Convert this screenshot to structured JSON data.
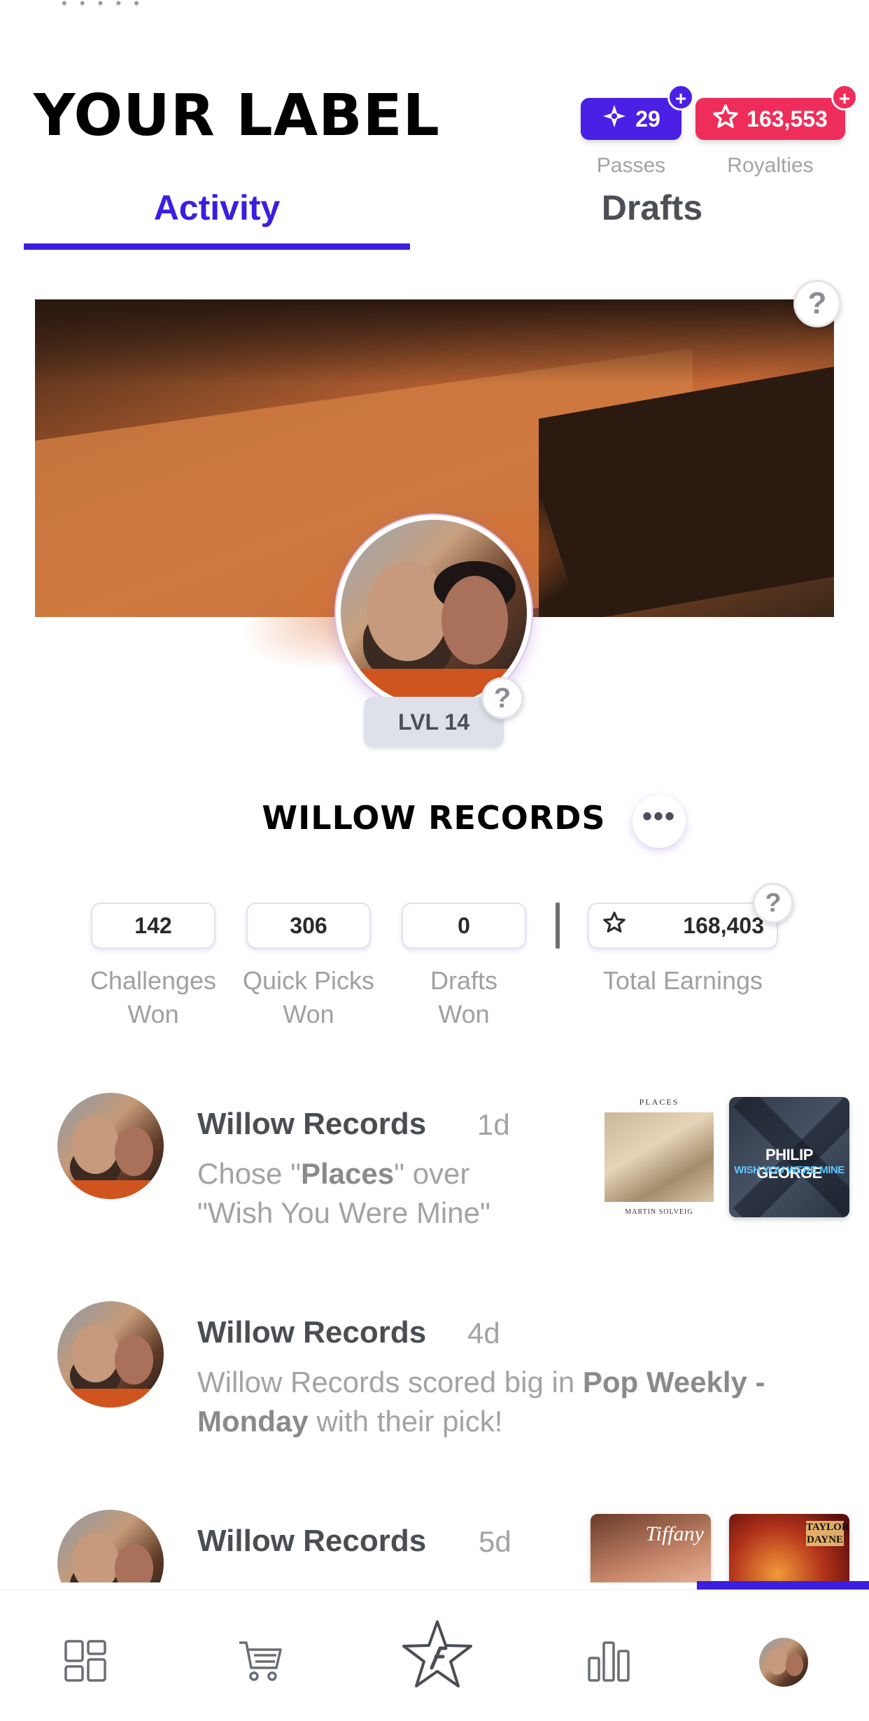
{
  "header": {
    "title": "YOUR LABEL",
    "passes": {
      "value": "29",
      "label": "Passes",
      "color": "#4a1fe6"
    },
    "royalties": {
      "value": "163,553",
      "label": "Royalties",
      "color": "#ef2d5a"
    },
    "plus": "+"
  },
  "tabs": [
    {
      "label": "Activity",
      "active": true
    },
    {
      "label": "Drafts",
      "active": false
    }
  ],
  "profile": {
    "level": "LVL 14",
    "name": "WILLOW RECORDS",
    "more": "•••",
    "help": "?"
  },
  "stats": [
    {
      "value": "142",
      "label_line1": "Challenges",
      "label_line2": "Won"
    },
    {
      "value": "306",
      "label_line1": "Quick Picks",
      "label_line2": "Won"
    },
    {
      "value": "0",
      "label_line1": "Drafts",
      "label_line2": "Won"
    },
    {
      "value": "168,403",
      "label_line1": "Total Earnings",
      "icon": "star-icon"
    }
  ],
  "feed": [
    {
      "name": "Willow Records",
      "time": "1d",
      "text_parts": [
        "Chose \"",
        "Places",
        "\" over",
        "\"Wish You Were Mine\""
      ],
      "albums": [
        {
          "title_top": "PLACES",
          "title_bottom": "MARTIN SOLVEIG"
        },
        {
          "artist": "PHILIP GEORGE",
          "title": "WISH YOU WERE MINE"
        }
      ]
    },
    {
      "name": "Willow Records",
      "time": "4d",
      "text_parts": [
        "Willow Records scored big in ",
        "Pop Weekly -",
        "Monday",
        " with their pick!"
      ]
    },
    {
      "name": "Willow Records",
      "time": "5d",
      "albums": [
        {
          "cover_text": "Tiffany"
        },
        {
          "cover_text": "TAYLOR DAYNE"
        }
      ]
    }
  ],
  "nav": {
    "items": [
      "home-icon",
      "cart-icon",
      "draft-star-icon",
      "stats-icon",
      "profile-avatar"
    ],
    "accent": "#3a1fe0"
  }
}
